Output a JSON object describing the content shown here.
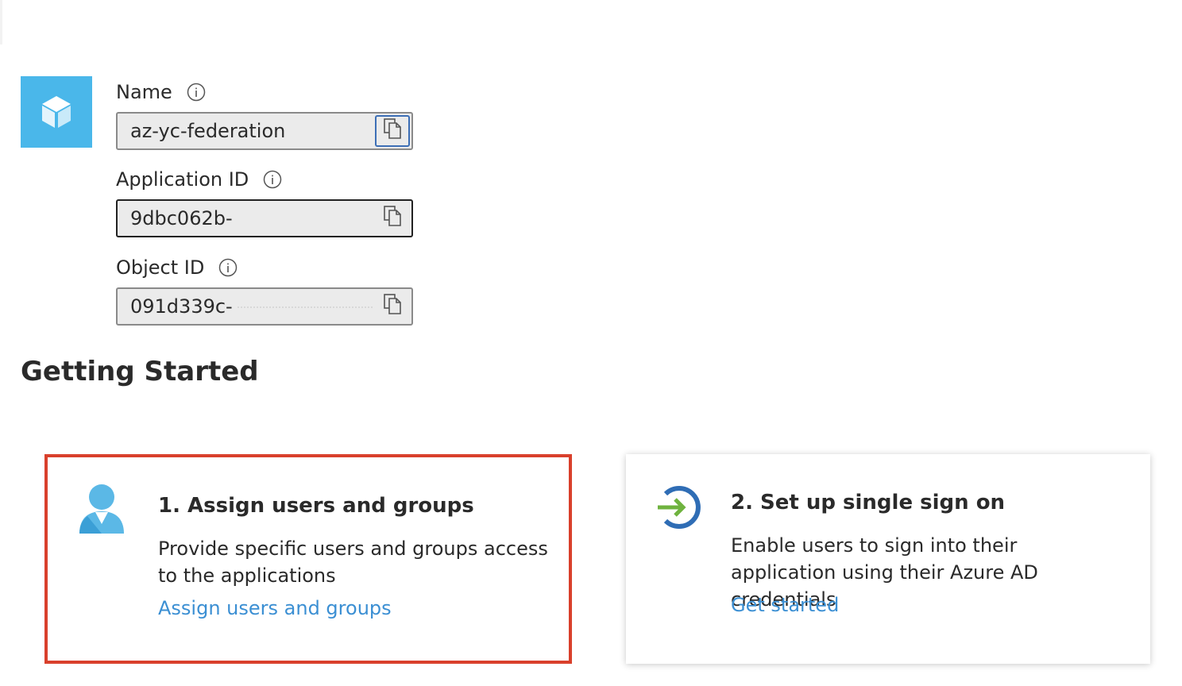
{
  "app": {
    "icon": "app-cube-icon",
    "brand_color": "#4ab7ea"
  },
  "fields": {
    "name": {
      "label": "Name",
      "value": "az-yc-federation",
      "copy_icon": "copy-icon"
    },
    "application_id": {
      "label": "Application ID",
      "value": "9dbc062b-",
      "copy_icon": "copy-icon"
    },
    "object_id": {
      "label": "Object ID",
      "value": "091d339c-",
      "copy_icon": "copy-icon"
    }
  },
  "getting_started": {
    "title": "Getting Started",
    "cards": [
      {
        "title": "1. Assign users and groups",
        "description": "Provide specific users and groups access to the applications",
        "link": "Assign users and groups",
        "icon": "user-icon",
        "highlight_color": "#d9402c"
      },
      {
        "title": "2. Set up single sign on",
        "description": "Enable users to sign into their application using their Azure AD credentials",
        "link": "Get started",
        "icon": "sign-in-arrow-icon"
      }
    ]
  },
  "colors": {
    "link": "#3b8fd3"
  }
}
